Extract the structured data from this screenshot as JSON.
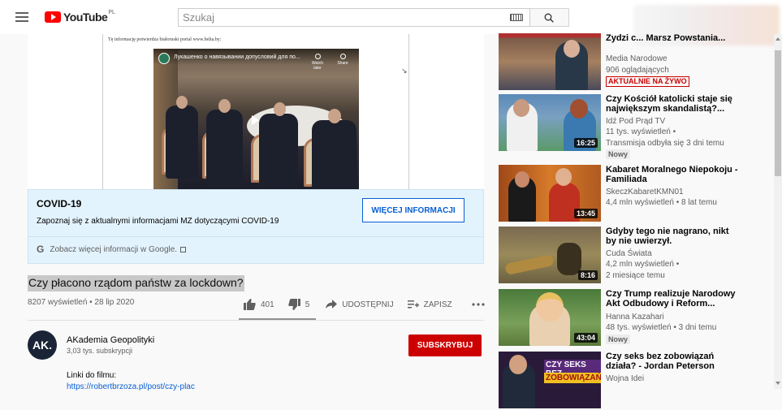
{
  "header": {
    "logo_text": "YouTube",
    "region": "PL",
    "search_placeholder": "Szukaj",
    "search_value": ""
  },
  "player": {
    "doc_caption": "Tę informację potwierdza białoruski portal www.belta.by:",
    "embed_title": "Лукашенко о навязывании допусловий для по...",
    "watch_later": "Watch later",
    "share": "Share"
  },
  "covid": {
    "title": "COVID-19",
    "description": "Zapoznaj się z aktualnymi informacjami MZ dotyczącymi COVID-19",
    "button": "WIĘCEJ INFORMACJI",
    "google_link": "Zobacz więcej informacji w Google."
  },
  "video": {
    "title": "Czy płacono rządom państw za lockdown?",
    "views_date": "8207 wyświetleń • 28 lip 2020",
    "likes": "401",
    "dislikes": "5",
    "share": "UDOSTĘPNIJ",
    "save": "ZAPISZ"
  },
  "channel": {
    "avatar_text": "AK.",
    "name": "AKademia Geopolityki",
    "subs": "3,03 tys. subskrypcji",
    "subscribe": "SUBSKRYBUJ",
    "desc_line": "Linki do filmu:",
    "desc_link": "https://robertbrzoza.pl/post/czy-plac"
  },
  "sidebar": [
    {
      "title": "Zydzi c... Marsz Powstania...",
      "channel": "Media Narodowe",
      "meta1": "906 oglądających",
      "badge_live": "AKTUALNIE NA ŻYWO",
      "thumb_color": "#8a5a40"
    },
    {
      "title": "Czy Kościół katolicki staje się największym skandalistą?...",
      "channel": "Idź Pod Prąd TV",
      "meta1": "11 tys. wyświetleń •",
      "meta2": "Transmisja odbyła się 3 dni temu",
      "badge_new": "Nowy",
      "duration": "16:25",
      "thumb_color": "#5a9a6a"
    },
    {
      "title": "Kabaret Moralnego Niepokoju - Familiada",
      "channel": "SkeczKabaretKMN01",
      "meta1": "4,4 mln wyświetleń • 8 lat temu",
      "duration": "13:45",
      "thumb_color": "#c66a2a"
    },
    {
      "title": "Gdyby tego nie nagrano, nikt by nie uwierzył.",
      "channel": "Cuda Świata",
      "meta1": "4,2 mln wyświetleń •",
      "meta2": "2 miesiące temu",
      "duration": "8:16",
      "thumb_color": "#9a7a4a"
    },
    {
      "title": "Czy Trump realizuje Narodowy Akt Odbudowy i Reform...",
      "channel": "Hanna Kazahari",
      "meta1": "48 tys. wyświetleń • 3 dni temu",
      "badge_new": "Nowy",
      "duration": "43:04",
      "thumb_color": "#6a8a4a"
    },
    {
      "title": "Czy seks bez zobowiązań działa? - Jordan Peterson",
      "channel": "Wojna Idei",
      "thumb_text1": "CZY SEKS BEZ",
      "thumb_text2": "ZOBOWIĄZAŃ",
      "thumb_color": "#3a2a5a"
    }
  ]
}
